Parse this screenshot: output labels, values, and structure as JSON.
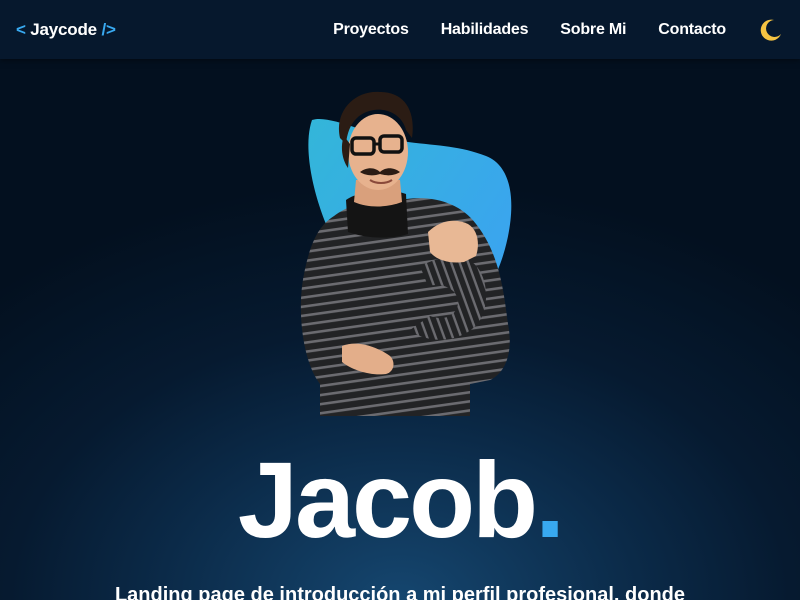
{
  "nav": {
    "brand_open": "<",
    "brand_name": "Jaycode",
    "brand_close": "/>",
    "links": [
      {
        "label": "Proyectos"
      },
      {
        "label": "Habilidades"
      },
      {
        "label": "Sobre Mi"
      },
      {
        "label": "Contacto"
      }
    ],
    "theme_icon": "moon-icon"
  },
  "hero": {
    "name": "Jacob",
    "name_dot": ".",
    "subtitle": "Landing page de introducción a mi perfil profesional, donde"
  },
  "colors": {
    "accent": "#38a9f0",
    "navbar": "#06182d",
    "moon": "#f5c342",
    "text": "#ffffff"
  }
}
